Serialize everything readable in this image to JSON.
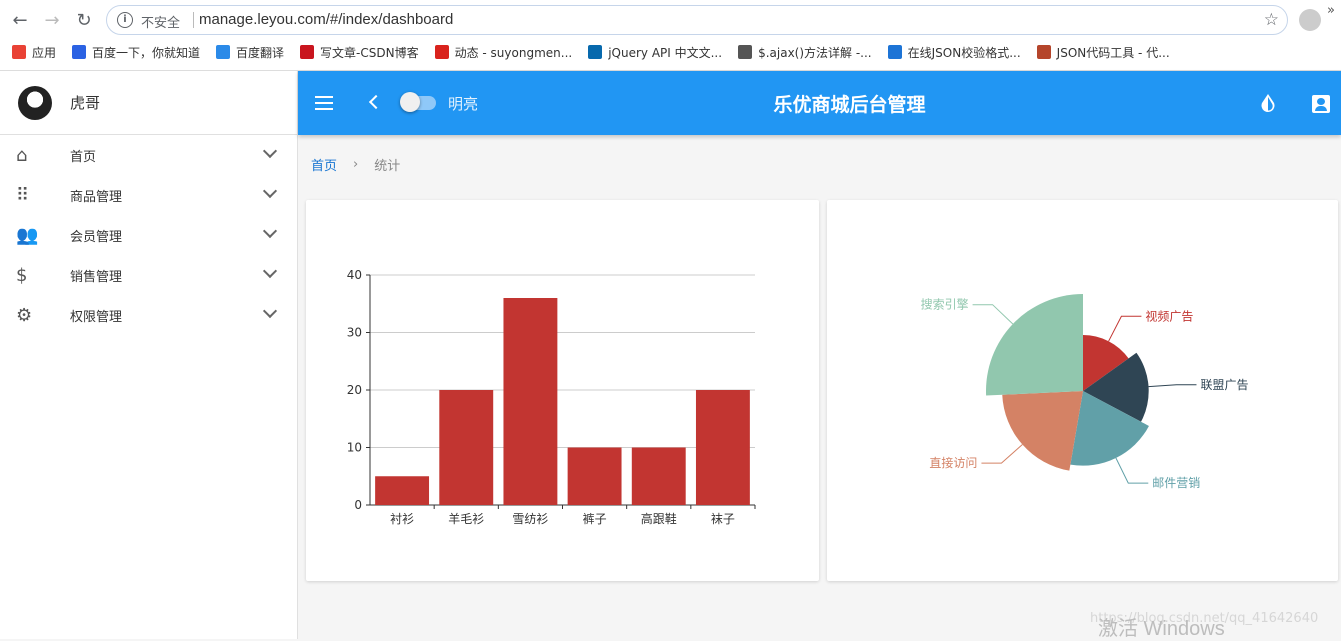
{
  "browser": {
    "insecure_label": "不安全",
    "url": "manage.leyou.com/#/index/dashboard",
    "bookmarks": [
      {
        "label": "应用",
        "color": "#e94235"
      },
      {
        "label": "百度一下，你就知道",
        "color": "#2b62e3"
      },
      {
        "label": "百度翻译",
        "color": "#2b8ae8"
      },
      {
        "label": "写文章-CSDN博客",
        "color": "#c9151e"
      },
      {
        "label": "动态 - suyongmen...",
        "color": "#d9231d"
      },
      {
        "label": "jQuery API 中文文...",
        "color": "#0769ad"
      },
      {
        "label": "$.ajax()方法详解 -...",
        "color": "#555555"
      },
      {
        "label": "在线JSON校验格式...",
        "color": "#1d74d6"
      },
      {
        "label": "JSON代码工具 - 代...",
        "color": "#b5452b"
      }
    ]
  },
  "sidebar": {
    "user_name": "虎哥",
    "items": [
      {
        "label": "首页",
        "icon": "home-icon"
      },
      {
        "label": "商品管理",
        "icon": "apps-icon"
      },
      {
        "label": "会员管理",
        "icon": "people-icon"
      },
      {
        "label": "销售管理",
        "icon": "dollar-icon"
      },
      {
        "label": "权限管理",
        "icon": "settings-icon"
      }
    ]
  },
  "topbar": {
    "theme_label": "明亮",
    "title": "乐优商城后台管理",
    "color": "#2196f3"
  },
  "breadcrumb": {
    "home": "首页",
    "current": "统计"
  },
  "chart_data": [
    {
      "type": "bar",
      "categories": [
        "衬衫",
        "羊毛衫",
        "雪纺衫",
        "裤子",
        "高跟鞋",
        "袜子"
      ],
      "values": [
        5,
        20,
        36,
        10,
        10,
        20
      ],
      "ylim": [
        0,
        40
      ],
      "yticks": [
        0,
        10,
        20,
        30,
        40
      ],
      "color": "#c23531",
      "grid": true
    },
    {
      "type": "pie",
      "rose_type": "radius",
      "slices": [
        {
          "name": "视频广告",
          "value": 235,
          "color": "#c23531"
        },
        {
          "name": "联盟广告",
          "value": 274,
          "color": "#2f4554"
        },
        {
          "name": "邮件营销",
          "value": 310,
          "color": "#61a0a8"
        },
        {
          "name": "直接访问",
          "value": 335,
          "color": "#d48265"
        },
        {
          "name": "搜索引擎",
          "value": 400,
          "color": "#91c7ae"
        }
      ]
    }
  ],
  "watermark": "激活 Windows",
  "csdn_mark": "https://blog.csdn.net/qq_41642640"
}
